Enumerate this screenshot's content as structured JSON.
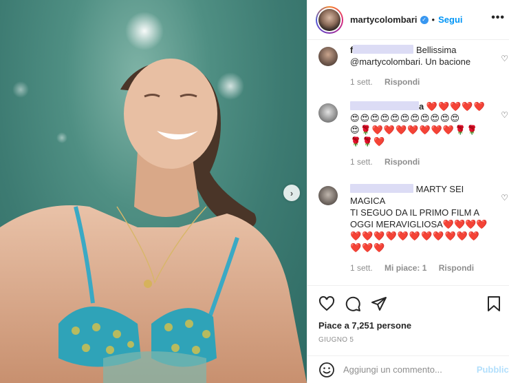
{
  "post": {
    "username": "martycolombari",
    "follow_label": "Segui",
    "more_label": "•••",
    "likes_text": "Piace a 7,251 persone",
    "date_text": "GIUGNO 5"
  },
  "comments": [
    {
      "author_visible": "f",
      "text": "Bellissima @martycolombari. Un bacione",
      "time": "1 sett.",
      "reply_label": "Rispondi"
    },
    {
      "author_visible": "a",
      "text_emoji_line1": "❤️❤️❤️❤️❤️",
      "text_emoji_line2": "😍😍😍😍😍😍😍😍😍😍😍",
      "text_emoji_line3": "😍🌹❤️❤️❤️❤️❤️❤️❤️🌹🌹",
      "text_emoji_line4": "🌹🌹❤️",
      "time": "1 sett.",
      "reply_label": "Rispondi"
    },
    {
      "text_line1": "MARTY SEI MAGICA",
      "text_line2": "TI SEGUO DA IL PRIMO FILM A",
      "text_line3": "OGGI MERAVIGLIOSA❤️❤️❤️❤️",
      "text_emoji_line4": "❤️❤️❤️❤️❤️❤️❤️❤️❤️❤️❤️",
      "text_emoji_line5": "❤️❤️❤️",
      "time": "1 sett.",
      "likes": "Mi piace: 1",
      "reply_label": "Rispondi"
    }
  ],
  "composer": {
    "placeholder": "Aggiungi un commento...",
    "publish_label": "Pubblica"
  },
  "colors": {
    "accent": "#0095f6",
    "publish_disabled": "#b2dffc",
    "water": "#3d7b72"
  },
  "icons": [
    "verified-icon",
    "heart-icon",
    "comment-icon",
    "share-icon",
    "bookmark-icon",
    "smiley-icon",
    "chevron-right-icon"
  ]
}
